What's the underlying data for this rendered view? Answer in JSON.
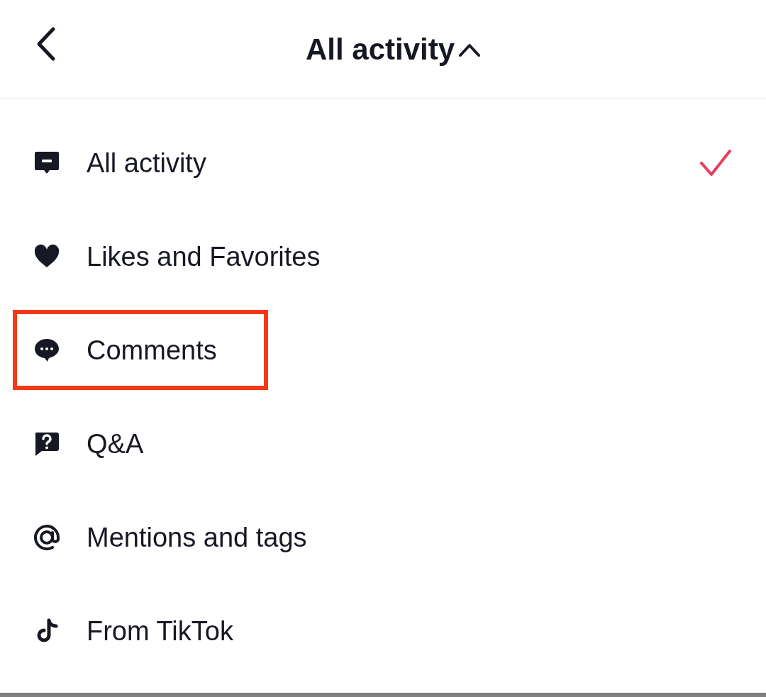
{
  "header": {
    "title": "All activity",
    "expanded": true
  },
  "items": [
    {
      "kind": "message",
      "label": "All activity",
      "selected": true,
      "highlighted": false
    },
    {
      "kind": "heart",
      "label": "Likes and Favorites",
      "selected": false,
      "highlighted": false
    },
    {
      "kind": "comment",
      "label": "Comments",
      "selected": false,
      "highlighted": true
    },
    {
      "kind": "question",
      "label": "Q&A",
      "selected": false,
      "highlighted": false
    },
    {
      "kind": "at",
      "label": "Mentions and tags",
      "selected": false,
      "highlighted": false
    },
    {
      "kind": "note",
      "label": "From TikTok",
      "selected": false,
      "highlighted": false
    }
  ]
}
